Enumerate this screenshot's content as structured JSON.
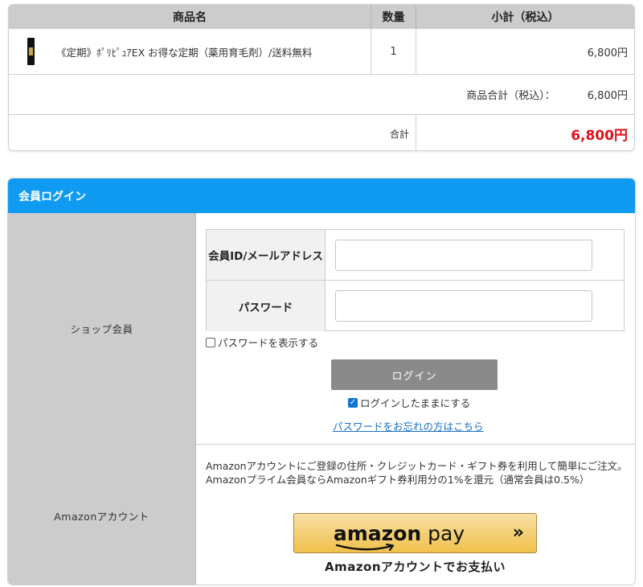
{
  "cart": {
    "headers": {
      "name": "商品名",
      "qty": "数量",
      "subtotal": "小計（税込）"
    },
    "item": {
      "name": "《定期》ﾎﾟﾘﾋﾟｭｱEX お得な定期（薬用育毛剤）/送料無料",
      "qty": "1",
      "subtotal": "6,800円"
    },
    "goods_total_label": "商品合計（税込）：",
    "goods_total_value": "6,800円",
    "total_label": "合計",
    "total_value": "6,800円",
    "total_color": "#e0111b"
  },
  "login": {
    "title": "会員ログイン",
    "header_color": "#0f9bf2",
    "shop_member_label": "ショップ会員",
    "id_label": "会員ID/メールアドレス",
    "id_value": "",
    "password_label": "パスワード",
    "password_value": "",
    "show_password_label": "パスワードを表示する",
    "show_password_checked": false,
    "login_button": "ログイン",
    "keep_logged_in_label": "ログインしたままにする",
    "keep_logged_in_checked": true,
    "forgot_link": "パスワードをお忘れの方はこちら"
  },
  "amazon": {
    "label": "Amazonアカウント",
    "description_line1": "Amazonアカウントにご登録の住所・クレジットカード・ギフト券を利用して簡単にご注文。",
    "description_line2": "Amazonプライム会員ならAmazonギフト券利用分の1%を還元（通常会員は0.5%）",
    "pay_logo_bold": "amazon",
    "pay_logo_light": " pay",
    "pay_arrow": "»",
    "pay_caption": "Amazonアカウントでお支払い"
  }
}
